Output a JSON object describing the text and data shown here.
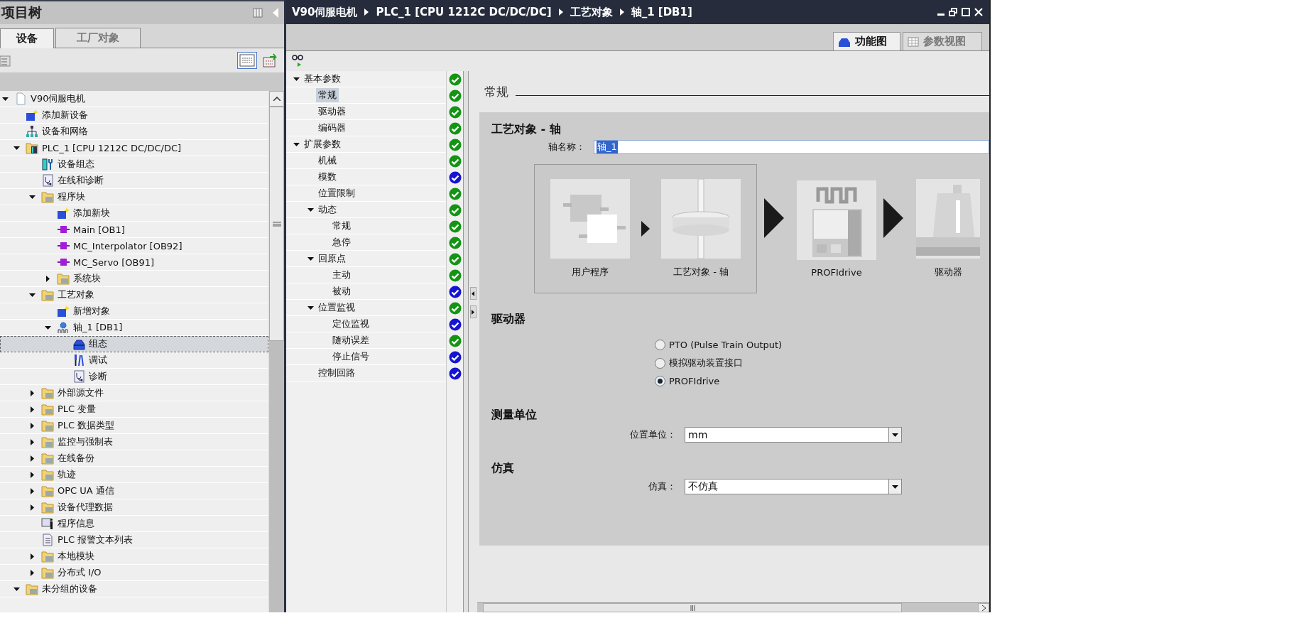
{
  "project_tree": {
    "title": "项目树",
    "tabs": [
      {
        "label": "设备",
        "selected": true
      },
      {
        "label": "工厂对象",
        "selected": false
      }
    ],
    "items": [
      {
        "label": "V90伺服电机",
        "kind": "document",
        "expanded": true,
        "selected": false,
        "children": [
          {
            "label": "添加新设备",
            "kind": "add",
            "selected": false
          },
          {
            "label": "设备和网络",
            "kind": "network",
            "selected": false
          },
          {
            "label": "PLC_1 [CPU 1212C DC/DC/DC]",
            "kind": "plc",
            "expanded": true,
            "selected": false,
            "children": [
              {
                "label": "设备组态",
                "kind": "config",
                "selected": false
              },
              {
                "label": "在线和诊断",
                "kind": "diag",
                "selected": false
              },
              {
                "label": "程序块",
                "kind": "folder",
                "expanded": true,
                "selected": false,
                "children": [
                  {
                    "label": "添加新块",
                    "kind": "add",
                    "selected": false
                  },
                  {
                    "label": "Main [OB1]",
                    "kind": "block",
                    "selected": false
                  },
                  {
                    "label": "MC_Interpolator [OB92]",
                    "kind": "block",
                    "selected": false
                  },
                  {
                    "label": "MC_Servo [OB91]",
                    "kind": "block",
                    "selected": false
                  },
                  {
                    "label": "系统块",
                    "kind": "folder",
                    "expanded": false,
                    "selected": false
                  }
                ]
              },
              {
                "label": "工艺对象",
                "kind": "folder",
                "expanded": true,
                "selected": false,
                "children": [
                  {
                    "label": "新增对象",
                    "kind": "add",
                    "selected": false
                  },
                  {
                    "label": "轴_1 [DB1]",
                    "kind": "gear",
                    "expanded": true,
                    "selected": false,
                    "children": [
                      {
                        "label": "组态",
                        "kind": "toolbox",
                        "selected": true
                      },
                      {
                        "label": "调试",
                        "kind": "tools",
                        "selected": false
                      },
                      {
                        "label": "诊断",
                        "kind": "diag",
                        "selected": false
                      }
                    ]
                  }
                ]
              },
              {
                "label": "外部源文件",
                "kind": "folder",
                "expanded": false,
                "selected": false
              },
              {
                "label": "PLC 变量",
                "kind": "folder",
                "expanded": false,
                "selected": false
              },
              {
                "label": "PLC 数据类型",
                "kind": "folder",
                "expanded": false,
                "selected": false
              },
              {
                "label": "监控与强制表",
                "kind": "folder",
                "expanded": false,
                "selected": false
              },
              {
                "label": "在线备份",
                "kind": "folder",
                "expanded": false,
                "selected": false
              },
              {
                "label": "轨迹",
                "kind": "folder",
                "expanded": false,
                "selected": false
              },
              {
                "label": "OPC UA 通信",
                "kind": "folder",
                "expanded": false,
                "selected": false
              },
              {
                "label": "设备代理数据",
                "kind": "folder",
                "expanded": false,
                "selected": false
              },
              {
                "label": "程序信息",
                "kind": "info",
                "selected": false
              },
              {
                "label": "PLC 报警文本列表",
                "kind": "list",
                "selected": false
              },
              {
                "label": "本地模块",
                "kind": "folder",
                "expanded": false,
                "selected": false
              },
              {
                "label": "分布式 I/O",
                "kind": "folder",
                "expanded": false,
                "selected": false
              }
            ]
          },
          {
            "label": "未分组的设备",
            "kind": "folder",
            "expanded": true,
            "selected": false
          }
        ]
      }
    ]
  },
  "editor": {
    "breadcrumb": [
      "V90伺服电机",
      "PLC_1 [CPU 1212C DC/DC/DC]",
      "工艺对象",
      "轴_1 [DB1]"
    ],
    "view_tabs": [
      {
        "label": "功能图",
        "selected": true
      },
      {
        "label": "参数视图",
        "selected": false
      }
    ],
    "nav": [
      {
        "label": "基本参数",
        "expanded": true,
        "selected": false,
        "color": "#139413",
        "children": [
          {
            "label": "常规",
            "selected": true,
            "color": "#139413"
          },
          {
            "label": "驱动器",
            "selected": false,
            "color": "#139413"
          },
          {
            "label": "编码器",
            "selected": false,
            "color": "#139413"
          }
        ]
      },
      {
        "label": "扩展参数",
        "expanded": true,
        "selected": false,
        "color": "#139413",
        "children": [
          {
            "label": "机械",
            "selected": false,
            "color": "#139413"
          },
          {
            "label": "模数",
            "selected": false,
            "color": "#1414d2"
          },
          {
            "label": "位置限制",
            "selected": false,
            "color": "#139413"
          },
          {
            "label": "动态",
            "expanded": true,
            "selected": false,
            "color": "#139413",
            "children": [
              {
                "label": "常规",
                "selected": false,
                "color": "#139413"
              },
              {
                "label": "急停",
                "selected": false,
                "color": "#139413"
              }
            ]
          },
          {
            "label": "回原点",
            "expanded": true,
            "selected": false,
            "color": "#139413",
            "children": [
              {
                "label": "主动",
                "selected": false,
                "color": "#139413"
              },
              {
                "label": "被动",
                "selected": false,
                "color": "#1414d2"
              }
            ]
          },
          {
            "label": "位置监视",
            "expanded": true,
            "selected": false,
            "color": "#139413",
            "children": [
              {
                "label": "定位监视",
                "selected": false,
                "color": "#1414d2"
              },
              {
                "label": "随动误差",
                "selected": false,
                "color": "#139413"
              },
              {
                "label": "停止信号",
                "selected": false,
                "color": "#1414d2"
              }
            ]
          },
          {
            "label": "控制回路",
            "selected": false,
            "color": "#1414d2"
          }
        ]
      }
    ],
    "section_title": "常规",
    "panel_title": "工艺对象 - 轴",
    "axis_name": {
      "label": "轴名称：",
      "value": "轴_1"
    },
    "diagram": {
      "group": [
        {
          "label": "用户程序",
          "kind": "program"
        },
        {
          "label": "工艺对象 - 轴",
          "kind": "axis"
        }
      ],
      "chain": [
        {
          "label": "PROFIdrive",
          "kind": "profidrive"
        },
        {
          "label": "驱动器",
          "kind": "drive"
        }
      ]
    },
    "drive": {
      "title": "驱动器",
      "options": [
        {
          "label": "PTO (Pulse Train Output)",
          "selected": false
        },
        {
          "label": "模拟驱动装置接口",
          "selected": false
        },
        {
          "label": "PROFIdrive",
          "selected": true
        }
      ]
    },
    "units": {
      "title": "测量单位",
      "label": "位置单位：",
      "value": "mm"
    },
    "simulation": {
      "title": "仿真",
      "label": "仿真：",
      "value": "不仿真"
    }
  }
}
